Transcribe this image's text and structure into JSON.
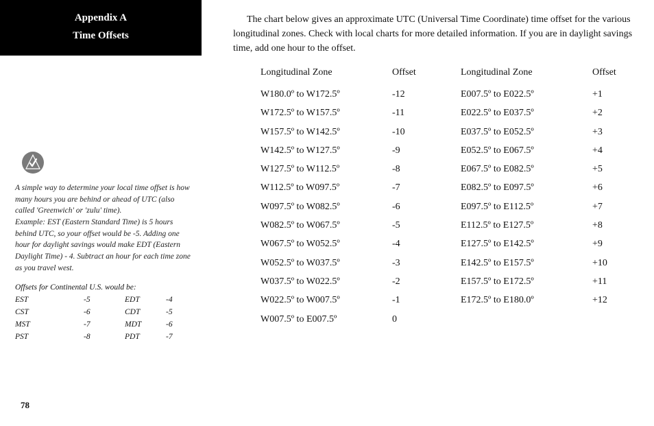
{
  "sidebar": {
    "title_line1": "Appendix A",
    "title_line2": "Time Offsets",
    "tip": "A simple way to determine your local time offset is how many hours you are behind or ahead of UTC (also called 'Greenwich' or 'zulu' time).\nExample: EST (Eastern Standard Time) is 5 hours behind UTC, so your offset would be -5. Adding one hour for daylight savings would make EDT (Eastern Daylight Time) - 4. Subtract an hour for each time zone as you travel west.",
    "us_title": "Offsets for Continental U.S. would be:",
    "us_rows": [
      {
        "a": "EST",
        "b": "-5",
        "c": "EDT",
        "d": "-4"
      },
      {
        "a": "CST",
        "b": "-6",
        "c": "CDT",
        "d": "-5"
      },
      {
        "a": "MST",
        "b": "-7",
        "c": "MDT",
        "d": "-6"
      },
      {
        "a": "PST",
        "b": "-8",
        "c": "PDT",
        "d": "-7"
      }
    ],
    "page_number": "78"
  },
  "main": {
    "intro": "The chart below gives an approximate UTC (Universal Time Coordinate) time offset for the various longitudinal zones. Check with local charts for more detailed information. If you are in daylight savings time, add one hour to the offset.",
    "header_zone": "Longitudinal Zone",
    "header_offset": "Offset",
    "left_rows": [
      {
        "zone": "W180.0º to W172.5º",
        "offset": "-12"
      },
      {
        "zone": "W172.5º to W157.5º",
        "offset": "-11"
      },
      {
        "zone": "W157.5º to W142.5º",
        "offset": "-10"
      },
      {
        "zone": "W142.5º to W127.5º",
        "offset": "-9"
      },
      {
        "zone": "W127.5º to W112.5º",
        "offset": "-8"
      },
      {
        "zone": "W112.5º to W097.5º",
        "offset": "-7"
      },
      {
        "zone": "W097.5º to W082.5º",
        "offset": "-6"
      },
      {
        "zone": "W082.5º to W067.5º",
        "offset": "-5"
      },
      {
        "zone": "W067.5º to W052.5º",
        "offset": "-4"
      },
      {
        "zone": "W052.5º to W037.5º",
        "offset": "-3"
      },
      {
        "zone": "W037.5º to W022.5º",
        "offset": "-2"
      },
      {
        "zone": "W022.5º to W007.5º",
        "offset": "-1"
      },
      {
        "zone": "W007.5º to E007.5º",
        "offset": " 0"
      }
    ],
    "right_rows": [
      {
        "zone": "E007.5º to E022.5º",
        "offset": "+1"
      },
      {
        "zone": "E022.5º to E037.5º",
        "offset": "+2"
      },
      {
        "zone": "E037.5º to E052.5º",
        "offset": "+3"
      },
      {
        "zone": "E052.5º to E067.5º",
        "offset": "+4"
      },
      {
        "zone": "E067.5º to E082.5º",
        "offset": "+5"
      },
      {
        "zone": "E082.5º to E097.5º",
        "offset": "+6"
      },
      {
        "zone": "E097.5º to E112.5º",
        "offset": "+7"
      },
      {
        "zone": "E112.5º to E127.5º",
        "offset": "+8"
      },
      {
        "zone": "E127.5º to E142.5º",
        "offset": "+9"
      },
      {
        "zone": "E142.5º to E157.5º",
        "offset": "+10"
      },
      {
        "zone": "E157.5º to E172.5º",
        "offset": "+11"
      },
      {
        "zone": "E172.5º to E180.0º",
        "offset": "+12"
      }
    ]
  }
}
